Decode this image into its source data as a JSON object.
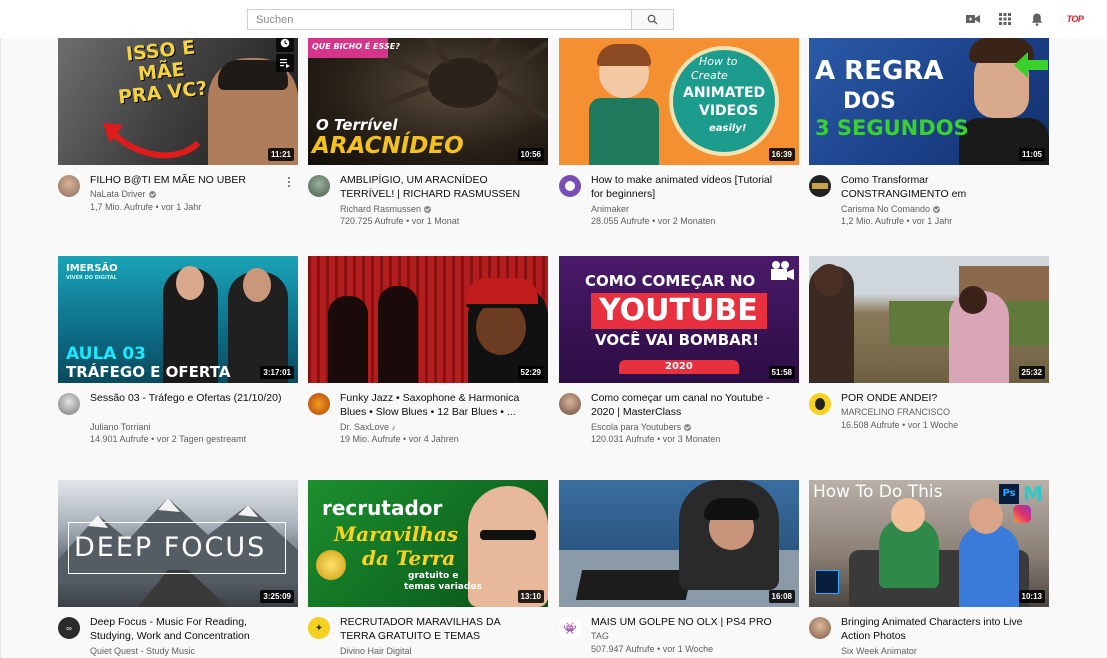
{
  "search": {
    "placeholder": "Suchen"
  },
  "header": {
    "account_badge": "TOP"
  },
  "videos": [
    {
      "title": "FILHO B@TI EM MÃE NO UBER",
      "channel": "NaLata Driver",
      "views": "1,7 Mio. Aufrufe",
      "age": "vor 1 Jahr",
      "duration": "11:21",
      "verified": true,
      "thumb_text": [
        "ISSO E",
        "MÃE",
        "PRA VC?"
      ]
    },
    {
      "title": "AMBLIPÍGIO, UM ARACNÍDEO TERRÍVEL! | RICHARD RASMUSSEN",
      "channel": "Richard Rasmussen",
      "views": "720.725 Aufrufe",
      "age": "vor 1 Monat",
      "duration": "10:56",
      "verified": true,
      "thumb_text": [
        "QUE BICHO É ESSE?",
        "O Terrível",
        "ARACNÍDEO"
      ]
    },
    {
      "title": "How to make animated videos [Tutorial for beginners]",
      "channel": "Animaker",
      "views": "28.055 Aufrufe",
      "age": "vor 2 Monaten",
      "duration": "16:39",
      "verified": false,
      "thumb_text": [
        "How to",
        "Create",
        "ANIMATED",
        "VIDEOS",
        "easily!"
      ]
    },
    {
      "title": "Como Transformar CONSTRANGIMENTO em CONFIANÇA...",
      "channel": "Carisma No Comando",
      "views": "1,2 Mio. Aufrufe",
      "age": "vor 1 Jahr",
      "duration": "11:05",
      "verified": true,
      "thumb_text": [
        "A REGRA",
        "DOS",
        "3 SEGUNDOS"
      ]
    },
    {
      "title": "Sessão 03 - Tráfego e Ofertas (21/10/20)",
      "channel": "Juliano Torriani",
      "views": "14.901 Aufrufe",
      "age": "vor 2 Tagen gestreamt",
      "duration": "3:17:01",
      "verified": false,
      "thumb_text": [
        "IMERSÃO",
        "VIVER DO DIGITAL",
        "AULA 03",
        "TRÁFEGO E OFERTA"
      ]
    },
    {
      "title": "Funky Jazz • Saxophone & Harmonica Blues • Slow Blues • 12 Bar Blues • ...",
      "channel": "Dr. SaxLove",
      "views": "19 Mio. Aufrufe",
      "age": "vor 4 Jahren",
      "duration": "52:29",
      "verified": false,
      "thumb_text": []
    },
    {
      "title": "Como começar um canal no Youtube - 2020 | MasterClass",
      "channel": "Escola para Youtubers",
      "views": "120.031 Aufrufe",
      "age": "vor 3 Monaten",
      "duration": "51:58",
      "verified": true,
      "thumb_text": [
        "COMO COMEÇAR NO",
        "YOUTUBE",
        "VOCÊ VAI BOMBAR!",
        "2020"
      ]
    },
    {
      "title": "POR ONDE ANDEI?",
      "channel": "MARCELINO FRANCISCO",
      "views": "16.508 Aufrufe",
      "age": "vor 1 Woche",
      "duration": "25:32",
      "verified": false,
      "thumb_text": []
    },
    {
      "title": "Deep Focus - Music For Reading, Studying, Work and Concentration",
      "channel": "Quiet Quest - Study Music",
      "views": "",
      "age": "",
      "duration": "3:25:09",
      "verified": false,
      "thumb_text": [
        "DEEP FOCUS"
      ]
    },
    {
      "title": "RECRUTADOR MARAVILHAS DA TERRA GRATUITO E TEMAS ADICIONAIS...",
      "channel": "Divino Hair Digital",
      "views": "",
      "age": "",
      "duration": "13:10",
      "verified": false,
      "thumb_text": [
        "recrutador",
        "Maravilhas",
        "da Terra",
        "gratuito e",
        "temas variados"
      ]
    },
    {
      "title": "MAIS UM GOLPE NO OLX | PS4 PRO",
      "channel": "TAG",
      "views": "507.947 Aufrufe",
      "age": "vor 1 Woche",
      "duration": "16:08",
      "verified": false,
      "thumb_text": []
    },
    {
      "title": "Bringing Animated Characters into Live Action Photos",
      "channel": "Six Week Animator",
      "views": "",
      "age": "",
      "duration": "10:13",
      "verified": false,
      "thumb_text": [
        "How To Do This",
        "Ps",
        "M"
      ]
    }
  ],
  "colors": {
    "accent_red": "#ff0000",
    "meta_gray": "#606060"
  }
}
